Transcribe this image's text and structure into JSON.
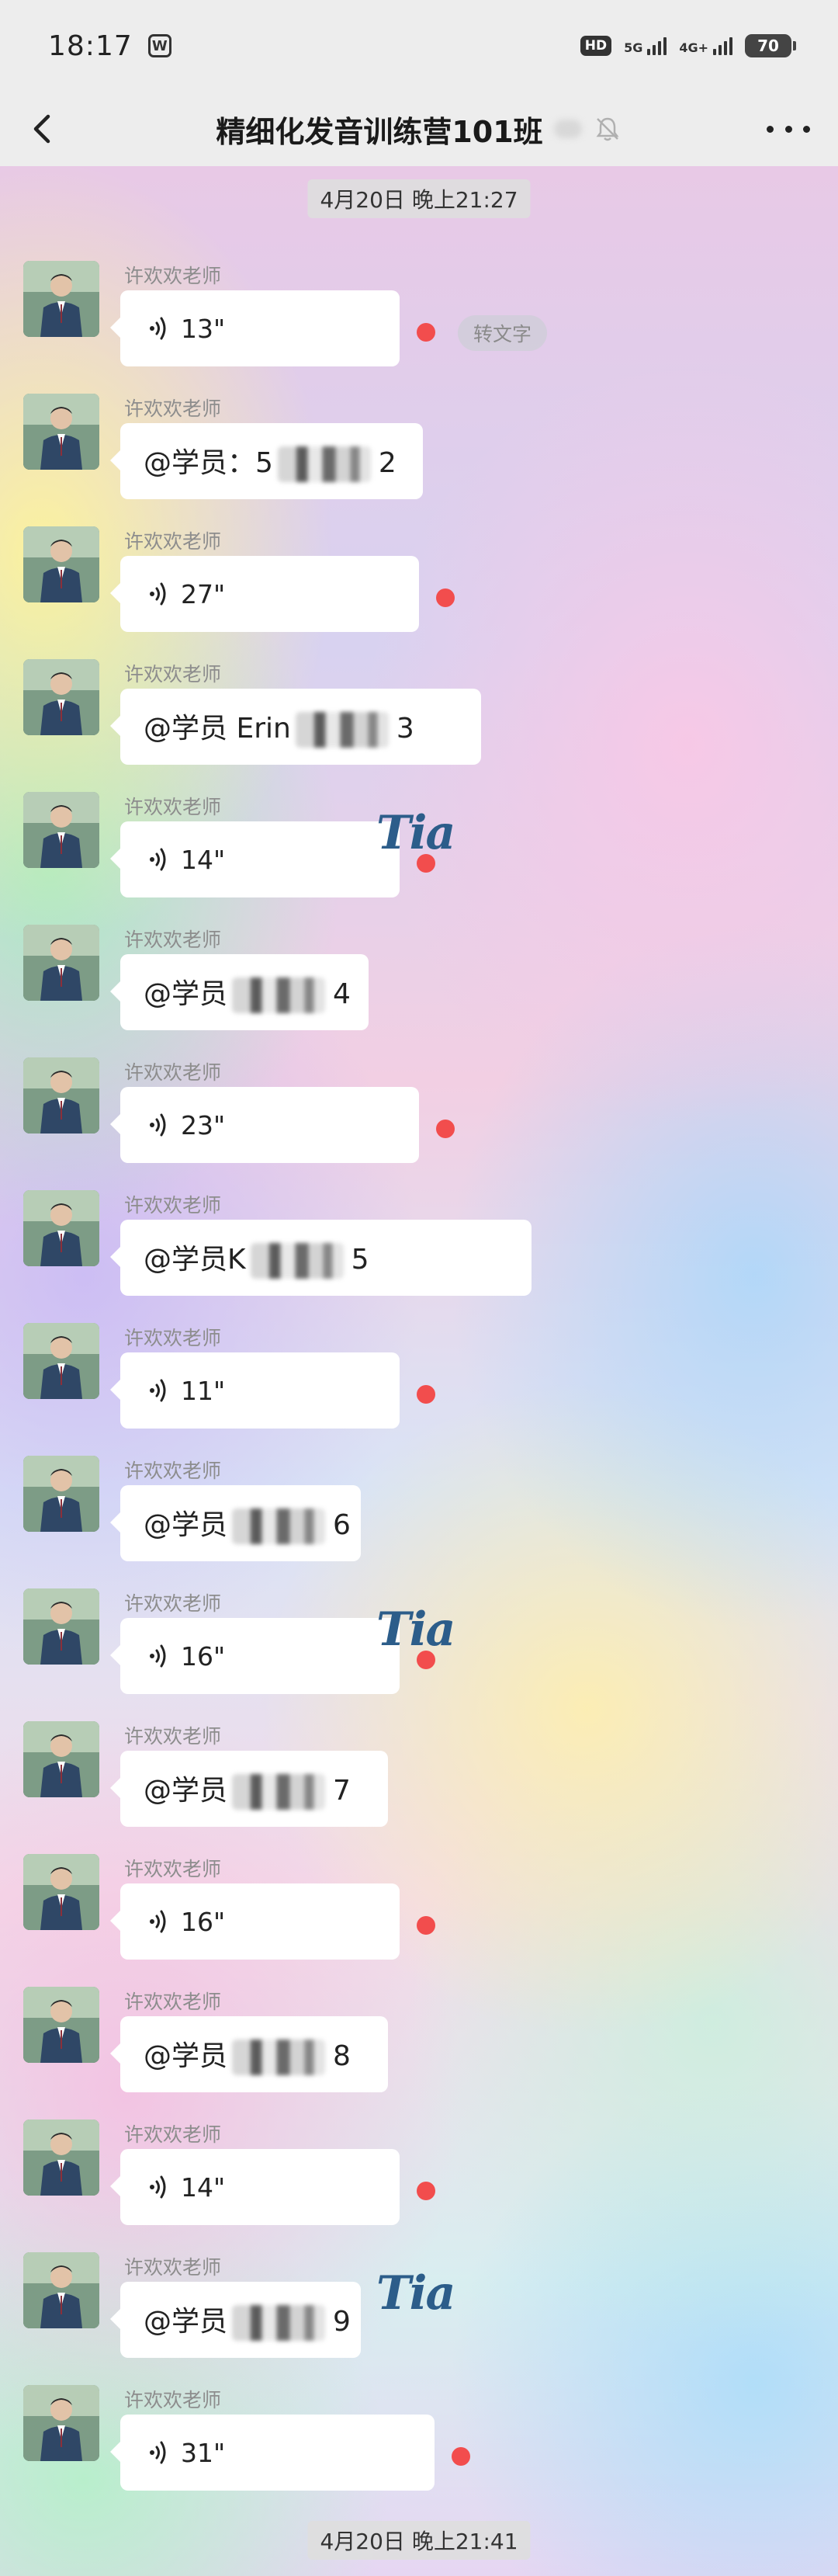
{
  "status_bar": {
    "time": "18:17",
    "app_icon": "W",
    "hd": "HD",
    "net1": "5G",
    "net2": "4G+",
    "battery": "70"
  },
  "nav": {
    "title": "精细化发音训练营101班"
  },
  "chat": {
    "timestamps": [
      "4月20日 晚上21:27",
      "4月20日 晚上21:41"
    ],
    "convert_text": "转文字",
    "watermark": "Tia",
    "messages": [
      {
        "sender": "许欢欢老师",
        "type": "voice",
        "duration": "13\"",
        "unread": true,
        "convert": true
      },
      {
        "sender": "许欢欢老师",
        "type": "mention",
        "prefix": "@学员：",
        "name": "5",
        "seq": "2"
      },
      {
        "sender": "许欢欢老师",
        "type": "voice",
        "duration": "27\"",
        "unread": true
      },
      {
        "sender": "许欢欢老师",
        "type": "mention",
        "prefix": "@学员 ",
        "name": "Erin",
        "seq": "3"
      },
      {
        "sender": "许欢欢老师",
        "type": "voice",
        "duration": "14\"",
        "unread": true,
        "watermark": true
      },
      {
        "sender": "许欢欢老师",
        "type": "mention",
        "prefix": "@学员",
        "name": "",
        "seq": "4"
      },
      {
        "sender": "许欢欢老师",
        "type": "voice",
        "duration": "23\"",
        "unread": true
      },
      {
        "sender": "许欢欢老师",
        "type": "mention",
        "prefix": "@学员",
        "name": "K",
        "seq": "5"
      },
      {
        "sender": "许欢欢老师",
        "type": "voice",
        "duration": "11\"",
        "unread": true
      },
      {
        "sender": "许欢欢老师",
        "type": "mention",
        "prefix": "@学员",
        "name": "",
        "seq": "6"
      },
      {
        "sender": "许欢欢老师",
        "type": "voice",
        "duration": "16\"",
        "unread": true,
        "watermark": true
      },
      {
        "sender": "许欢欢老师",
        "type": "mention",
        "prefix": "@学员",
        "name": "",
        "seq": "7"
      },
      {
        "sender": "许欢欢老师",
        "type": "voice",
        "duration": "16\"",
        "unread": true
      },
      {
        "sender": "许欢欢老师",
        "type": "mention",
        "prefix": "@学员",
        "name": "",
        "seq": "8"
      },
      {
        "sender": "许欢欢老师",
        "type": "voice",
        "duration": "14\"",
        "unread": true
      },
      {
        "sender": "许欢欢老师",
        "type": "mention",
        "prefix": "@学员",
        "name": "",
        "seq": "9",
        "watermark": true
      },
      {
        "sender": "许欢欢老师",
        "type": "voice",
        "duration": "31\"",
        "unread": true
      }
    ]
  },
  "colors": {
    "unread_dot": "#f24d4d",
    "bar_background": "#ededed",
    "bubble": "#ffffff",
    "watermark": "#2c5d8a"
  },
  "icons": [
    "back-arrow-icon",
    "mute-bell-icon",
    "more-options-icon",
    "voice-wave-icon",
    "avatar-photo"
  ]
}
